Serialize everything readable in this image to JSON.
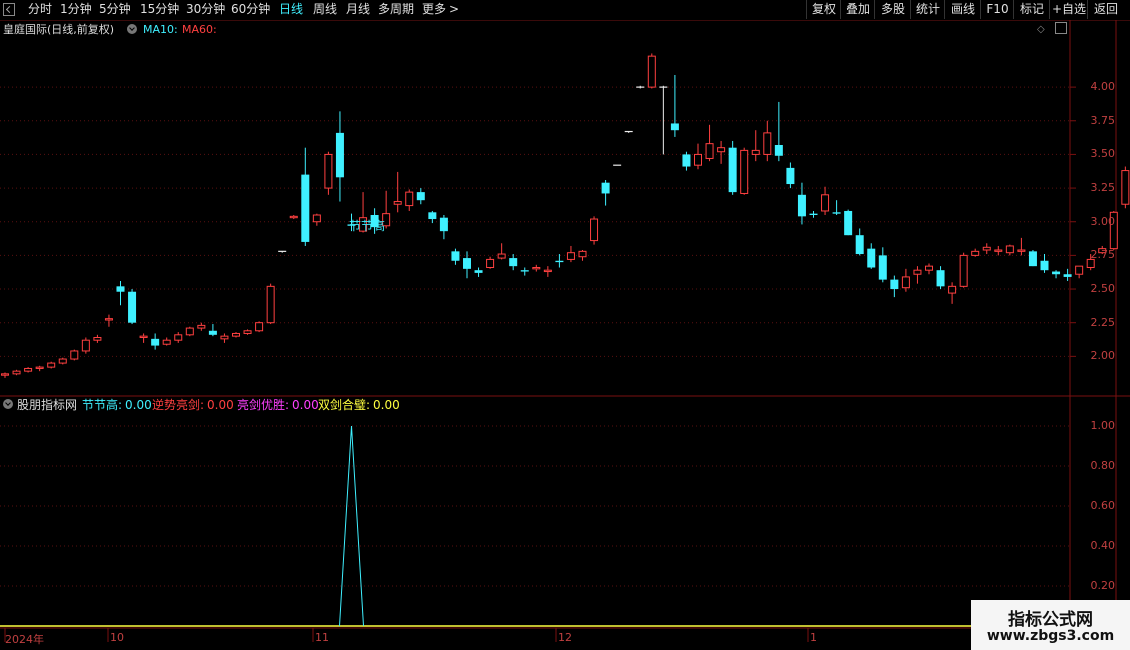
{
  "toolbar": {
    "periods": [
      "分时",
      "1分钟",
      "5分钟",
      "15分钟",
      "30分钟",
      "60分钟",
      "日线",
      "周线",
      "月线",
      "多周期",
      "更多"
    ],
    "active_period": "日线",
    "more_chevron": ">",
    "right_buttons": [
      "复权",
      "叠加",
      "多股",
      "统计",
      "画线",
      "F10",
      "标记",
      "+自选",
      "返回"
    ]
  },
  "main": {
    "title": "皇庭国际(日线,前复权)",
    "ma10_label": "MA10:",
    "ma60_label": "MA60:",
    "annotation": "节节高",
    "y_ticks": [
      "4.00",
      "3.75",
      "3.50",
      "3.25",
      "3.00",
      "2.75",
      "2.50",
      "2.25",
      "2.00"
    ]
  },
  "indicator": {
    "name": "股朋指标网",
    "values": [
      {
        "label": "节节高:",
        "value": "0.00",
        "color": "#3ff0ff"
      },
      {
        "label": "逆势亮剑:",
        "value": "0.00",
        "color": "#ff4040"
      },
      {
        "label": "亮剑优胜:",
        "value": "0.00",
        "color": "#ff40ff"
      },
      {
        "label": "双剑合璧:",
        "value": "0.00",
        "color": "#ffff40"
      }
    ],
    "y_ticks": [
      "1.00",
      "0.80",
      "0.60",
      "0.40",
      "0.20"
    ]
  },
  "x_axis": {
    "labels": [
      "2024年",
      "10",
      "11",
      "12",
      "1"
    ]
  },
  "watermark": {
    "line1": "指标公式网",
    "line2": "www.zbgs3.com"
  },
  "colors": {
    "up": "#ff4040",
    "down": "#3ff0ff",
    "axis": "#7a1010",
    "grid": "#5a1010"
  },
  "chart_data": [
    {
      "type": "candlestick",
      "title": "皇庭国际(日线,前复权)",
      "y_range": [
        1.75,
        4.35
      ],
      "y_ticks": [
        2.0,
        2.25,
        2.5,
        2.75,
        3.0,
        3.25,
        3.5,
        3.75,
        4.0
      ],
      "x_labels": [
        "2024年",
        "10",
        "11",
        "12",
        "1"
      ],
      "series": [
        {
          "name": "K",
          "ohlc": [
            [
              1.86,
              1.88,
              1.84,
              1.87
            ],
            [
              1.87,
              1.9,
              1.86,
              1.89
            ],
            [
              1.89,
              1.92,
              1.88,
              1.91
            ],
            [
              1.91,
              1.93,
              1.89,
              1.92
            ],
            [
              1.92,
              1.96,
              1.91,
              1.95
            ],
            [
              1.95,
              1.99,
              1.94,
              1.98
            ],
            [
              1.98,
              2.05,
              1.97,
              2.04
            ],
            [
              2.04,
              2.14,
              2.02,
              2.12
            ],
            [
              2.12,
              2.16,
              2.1,
              2.14
            ],
            [
              2.27,
              2.31,
              2.22,
              2.28
            ],
            [
              2.52,
              2.56,
              2.38,
              2.48
            ],
            [
              2.48,
              2.5,
              2.24,
              2.25
            ],
            [
              2.14,
              2.17,
              2.1,
              2.15
            ],
            [
              2.13,
              2.17,
              2.05,
              2.08
            ],
            [
              2.09,
              2.14,
              2.08,
              2.12
            ],
            [
              2.12,
              2.18,
              2.1,
              2.16
            ],
            [
              2.16,
              2.22,
              2.15,
              2.21
            ],
            [
              2.21,
              2.25,
              2.19,
              2.23
            ],
            [
              2.19,
              2.24,
              2.15,
              2.16
            ],
            [
              2.13,
              2.17,
              2.1,
              2.15
            ],
            [
              2.15,
              2.18,
              2.14,
              2.17
            ],
            [
              2.17,
              2.2,
              2.16,
              2.19
            ],
            [
              2.19,
              2.26,
              2.18,
              2.25
            ],
            [
              2.25,
              2.54,
              2.24,
              2.52
            ],
            [
              2.78,
              2.78,
              2.77,
              2.78
            ],
            [
              3.03,
              3.05,
              3.02,
              3.04
            ],
            [
              3.35,
              3.55,
              2.82,
              2.85
            ],
            [
              3.0,
              3.06,
              2.97,
              3.05
            ],
            [
              3.25,
              3.52,
              3.2,
              3.5
            ],
            [
              3.66,
              3.82,
              3.15,
              3.33
            ],
            [
              2.98,
              3.06,
              2.93,
              2.97
            ],
            [
              2.93,
              3.22,
              2.92,
              3.03
            ],
            [
              3.05,
              3.1,
              2.91,
              2.96
            ],
            [
              2.97,
              3.23,
              2.95,
              3.06
            ],
            [
              3.13,
              3.37,
              3.07,
              3.15
            ],
            [
              3.12,
              3.24,
              3.08,
              3.22
            ],
            [
              3.22,
              3.25,
              3.13,
              3.16
            ],
            [
              3.07,
              3.08,
              2.99,
              3.02
            ],
            [
              3.03,
              3.05,
              2.87,
              2.93
            ],
            [
              2.78,
              2.8,
              2.68,
              2.71
            ],
            [
              2.73,
              2.78,
              2.58,
              2.65
            ],
            [
              2.64,
              2.66,
              2.59,
              2.62
            ],
            [
              2.66,
              2.74,
              2.65,
              2.72
            ],
            [
              2.73,
              2.84,
              2.72,
              2.76
            ],
            [
              2.73,
              2.76,
              2.64,
              2.67
            ],
            [
              2.64,
              2.66,
              2.6,
              2.63
            ],
            [
              2.65,
              2.68,
              2.63,
              2.66
            ],
            [
              2.63,
              2.67,
              2.59,
              2.64
            ],
            [
              2.71,
              2.76,
              2.66,
              2.7
            ],
            [
              2.72,
              2.82,
              2.7,
              2.77
            ],
            [
              2.74,
              2.79,
              2.71,
              2.78
            ],
            [
              2.86,
              3.04,
              2.83,
              3.02
            ],
            [
              3.29,
              3.31,
              3.12,
              3.21
            ],
            [
              3.42,
              3.42,
              3.42,
              3.42
            ],
            [
              3.67,
              3.67,
              3.66,
              3.67
            ],
            [
              4.0,
              4.01,
              3.99,
              4.0
            ],
            [
              4.0,
              4.25,
              3.99,
              4.23
            ],
            [
              4.0,
              4.01,
              3.5,
              4.0
            ],
            [
              3.73,
              4.09,
              3.63,
              3.68
            ],
            [
              3.5,
              3.52,
              3.38,
              3.41
            ],
            [
              3.42,
              3.58,
              3.39,
              3.5
            ],
            [
              3.47,
              3.72,
              3.45,
              3.58
            ],
            [
              3.52,
              3.6,
              3.43,
              3.55
            ],
            [
              3.55,
              3.6,
              3.2,
              3.22
            ],
            [
              3.21,
              3.55,
              3.2,
              3.53
            ],
            [
              3.5,
              3.68,
              3.45,
              3.53
            ],
            [
              3.5,
              3.75,
              3.45,
              3.66
            ],
            [
              3.57,
              3.89,
              3.45,
              3.49
            ],
            [
              3.4,
              3.44,
              3.25,
              3.28
            ],
            [
              3.2,
              3.29,
              2.98,
              3.04
            ],
            [
              3.06,
              3.08,
              3.03,
              3.05
            ],
            [
              3.08,
              3.26,
              3.05,
              3.2
            ],
            [
              3.07,
              3.16,
              3.05,
              3.06
            ],
            [
              3.08,
              3.09,
              2.9,
              2.9
            ],
            [
              2.9,
              2.95,
              2.75,
              2.76
            ],
            [
              2.8,
              2.84,
              2.65,
              2.66
            ],
            [
              2.75,
              2.81,
              2.55,
              2.57
            ],
            [
              2.57,
              2.6,
              2.44,
              2.5
            ],
            [
              2.51,
              2.65,
              2.48,
              2.59
            ],
            [
              2.61,
              2.67,
              2.54,
              2.64
            ],
            [
              2.64,
              2.69,
              2.61,
              2.67
            ],
            [
              2.64,
              2.67,
              2.5,
              2.52
            ],
            [
              2.47,
              2.55,
              2.39,
              2.52
            ],
            [
              2.52,
              2.77,
              2.51,
              2.75
            ],
            [
              2.75,
              2.8,
              2.74,
              2.78
            ],
            [
              2.79,
              2.84,
              2.76,
              2.81
            ],
            [
              2.78,
              2.82,
              2.75,
              2.79
            ],
            [
              2.77,
              2.83,
              2.75,
              2.82
            ],
            [
              2.78,
              2.88,
              2.75,
              2.79
            ],
            [
              2.78,
              2.79,
              2.67,
              2.67
            ],
            [
              2.71,
              2.76,
              2.62,
              2.64
            ],
            [
              2.63,
              2.64,
              2.58,
              2.61
            ],
            [
              2.61,
              2.65,
              2.56,
              2.59
            ],
            [
              2.61,
              2.67,
              2.58,
              2.67
            ],
            [
              2.66,
              2.76,
              2.64,
              2.72
            ],
            [
              2.77,
              2.82,
              2.76,
              2.8
            ],
            [
              2.8,
              3.08,
              2.79,
              3.07
            ],
            [
              3.13,
              3.41,
              3.1,
              3.38
            ]
          ]
        }
      ],
      "annotations": [
        "节节高"
      ]
    },
    {
      "type": "line",
      "title": "股朋指标网",
      "y_range": [
        0,
        1.05
      ],
      "y_ticks": [
        0.2,
        0.4,
        0.6,
        0.8,
        1.0
      ],
      "series": [
        {
          "name": "节节高",
          "color": "#3ff0ff",
          "spike_at_index": 30,
          "peak": 1.0,
          "base": 0.0
        },
        {
          "name": "双剑合璧",
          "color": "#ffff40",
          "values": "constant 0"
        }
      ]
    }
  ]
}
